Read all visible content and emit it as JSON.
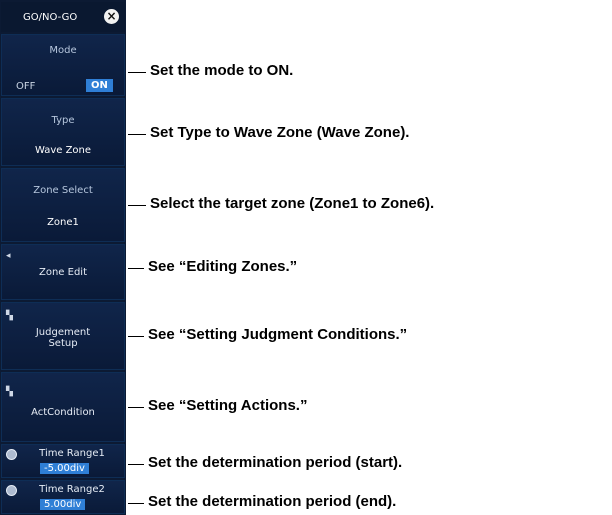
{
  "panel": {
    "title": "GO/NO-GO",
    "close_icon": "close-icon",
    "mode": {
      "label": "Mode",
      "off": "OFF",
      "on": "ON"
    },
    "type": {
      "label": "Type",
      "value": "Wave Zone"
    },
    "zone_select": {
      "label": "Zone Select",
      "value": "Zone1"
    },
    "zone_edit": {
      "label": "Zone Edit",
      "icon": "left-arrow-icon"
    },
    "judgment": {
      "label_line1": "Judgement",
      "label_line2": "Setup",
      "icon": "submenu-icon"
    },
    "act_condition": {
      "label": "ActCondition",
      "icon": "submenu-icon"
    },
    "time_range1": {
      "label": "Time Range1",
      "value": "-5.00div",
      "icon": "rotary-knob-icon"
    },
    "time_range2": {
      "label": "Time Range2",
      "value": "5.00div",
      "icon": "rotary-knob-icon"
    }
  },
  "annotations": {
    "mode": "Set the mode to ON.",
    "type": "Set Type to Wave Zone (Wave Zone).",
    "zone": "Select the target zone (Zone1 to Zone6).",
    "edit": "See “Editing Zones.”",
    "judgment": "See “Setting Judgment Conditions.”",
    "actions": "See “Setting Actions.”",
    "start": "Set the determination period (start).",
    "end": "Set the determination period (end)."
  }
}
